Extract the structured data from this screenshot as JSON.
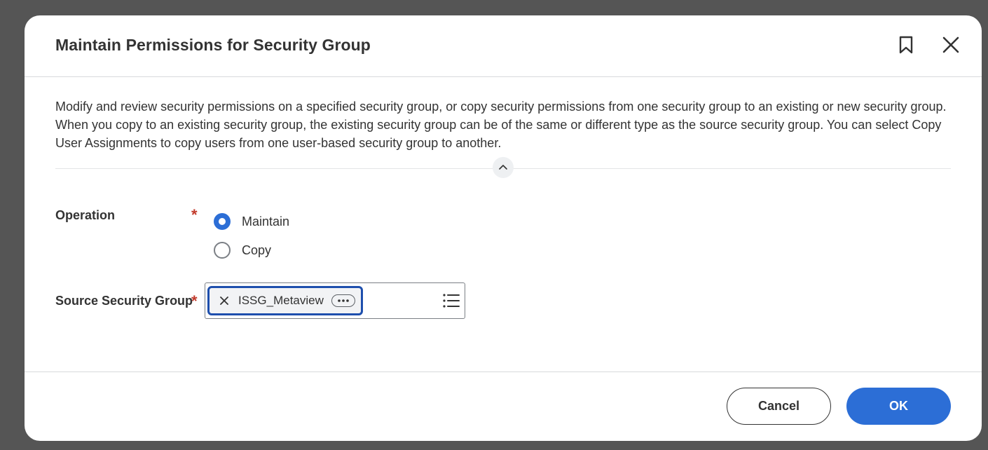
{
  "dialog": {
    "title": "Maintain Permissions for Security Group",
    "description": "Modify and review security permissions on a specified security group, or copy security permissions from one security group to an existing or new security group. When you copy to an existing security group, the existing security group can be of the same or different type as the source security group. You can select Copy User Assignments to copy users from one user-based security group to another."
  },
  "form": {
    "operation": {
      "label": "Operation",
      "required_mark": "*",
      "options": [
        {
          "label": "Maintain",
          "selected": true
        },
        {
          "label": "Copy",
          "selected": false
        }
      ]
    },
    "source_security_group": {
      "label": "Source Security Group",
      "required_mark": "*",
      "selected_value": "ISSG_Metaview"
    }
  },
  "footer": {
    "cancel_label": "Cancel",
    "ok_label": "OK"
  },
  "colors": {
    "accent": "#2c6ed6",
    "required": "#c23a2b",
    "focus_border": "#1e4fad",
    "backdrop": "#555555"
  },
  "icons": {
    "bookmark": "bookmark-icon",
    "close": "close-icon",
    "collapse": "chevron-up-icon",
    "pill_remove": "x-icon",
    "pill_more": "more-horizontal-icon",
    "prompt_list": "list-icon"
  }
}
